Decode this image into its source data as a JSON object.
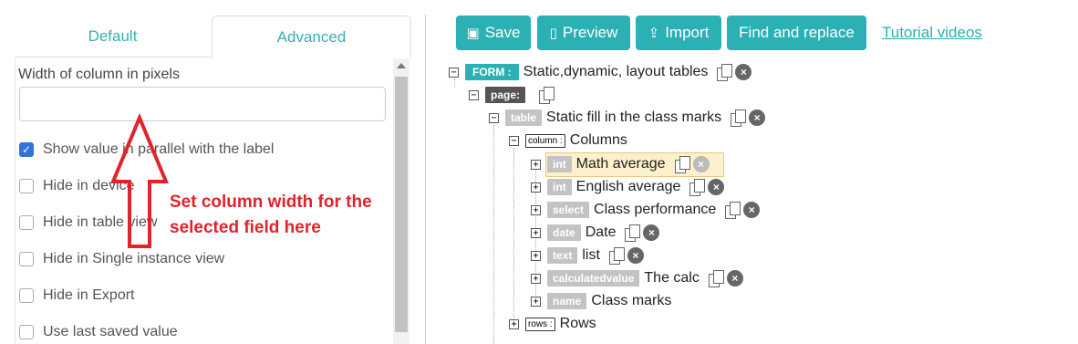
{
  "tabs": {
    "default": "Default",
    "advanced": "Advanced"
  },
  "settings": {
    "width_label": "Width of column in pixels",
    "width_value": "",
    "checkboxes": [
      {
        "label": "Show value in parallel with the label",
        "checked": true
      },
      {
        "label": "Hide in device",
        "checked": false
      },
      {
        "label": "Hide in table view",
        "checked": false
      },
      {
        "label": "Hide in Single instance view",
        "checked": false
      },
      {
        "label": "Hide in Export",
        "checked": false
      },
      {
        "label": "Use last saved value",
        "checked": false
      }
    ]
  },
  "annotation": {
    "line1": "Set column width for the",
    "line2": "selected field here"
  },
  "toolbar": {
    "save": "Save",
    "preview": "Preview",
    "import": "Import",
    "find_replace": "Find and replace",
    "tutorial": "Tutorial videos"
  },
  "tree": {
    "form": {
      "tag": "FORM :",
      "label": "Static,dynamic, layout tables"
    },
    "page": {
      "tag": "page:"
    },
    "table": {
      "tag": "table",
      "label": "Static fill in the class marks"
    },
    "column": {
      "tag": "column :",
      "label": "Columns"
    },
    "fields": [
      {
        "tag": "int",
        "label": "Math average"
      },
      {
        "tag": "int",
        "label": "English average"
      },
      {
        "tag": "select",
        "label": "Class performance"
      },
      {
        "tag": "date",
        "label": "Date"
      },
      {
        "tag": "text",
        "label": "list"
      },
      {
        "tag": "calculatedvalue",
        "label": "The calc"
      },
      {
        "tag": "name",
        "label": "Class marks"
      }
    ],
    "rows": {
      "tag": "rows :",
      "label": "Rows"
    }
  },
  "colors": {
    "accent": "#2bb0b4",
    "annotation": "#e0242b",
    "highlight": "#fdf0cc"
  }
}
